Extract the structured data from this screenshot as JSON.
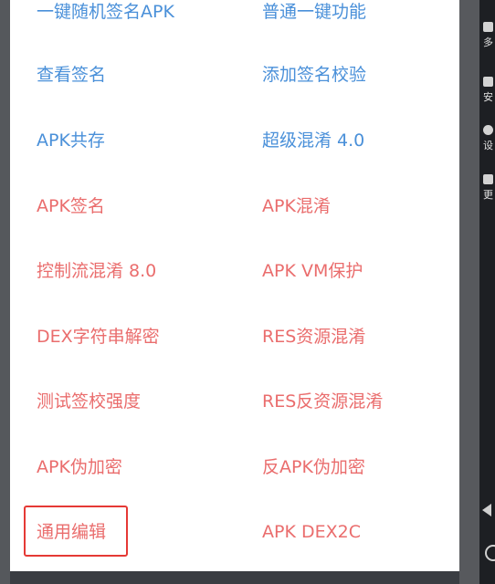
{
  "menu": {
    "left": [
      {
        "label": "一键随机签名APK",
        "color": "#4a90d9"
      },
      {
        "label": "查看签名",
        "color": "#4a90d9"
      },
      {
        "label": "APK共存",
        "color": "#4a90d9"
      },
      {
        "label": "APK签名",
        "color": "#ea6d6d"
      },
      {
        "label": "控制流混淆 8.0",
        "color": "#ea6d6d"
      },
      {
        "label": "DEX字符串解密",
        "color": "#ea6d6d"
      },
      {
        "label": "测试签校强度",
        "color": "#ea6d6d"
      },
      {
        "label": "APK伪加密",
        "color": "#ea6d6d"
      },
      {
        "label": "通用编辑",
        "color": "#ea6d6d"
      }
    ],
    "right": [
      {
        "label": "普通一键功能",
        "color": "#4a90d9"
      },
      {
        "label": "添加签名校验",
        "color": "#4a90d9"
      },
      {
        "label": "超级混淆 4.0",
        "color": "#4a90d9"
      },
      {
        "label": "APK混淆",
        "color": "#ea6d6d"
      },
      {
        "label": "APK VM保护",
        "color": "#ea6d6d"
      },
      {
        "label": "RES资源混淆",
        "color": "#ea6d6d"
      },
      {
        "label": "RES反资源混淆",
        "color": "#ea6d6d"
      },
      {
        "label": "反APK伪加密",
        "color": "#ea6d6d"
      },
      {
        "label": "APK DEX2C",
        "color": "#ea6d6d"
      }
    ],
    "highlight_color": "#e53935"
  },
  "sidebar": {
    "items": [
      {
        "label": "多",
        "icon": "grid-icon"
      },
      {
        "label": "安",
        "icon": "android-icon"
      },
      {
        "label": "设",
        "icon": "gear-icon"
      },
      {
        "label": "更",
        "icon": "more-icon"
      }
    ],
    "nav": {
      "back_icon": "back-triangle-icon",
      "home_icon": "home-circle-icon"
    }
  }
}
